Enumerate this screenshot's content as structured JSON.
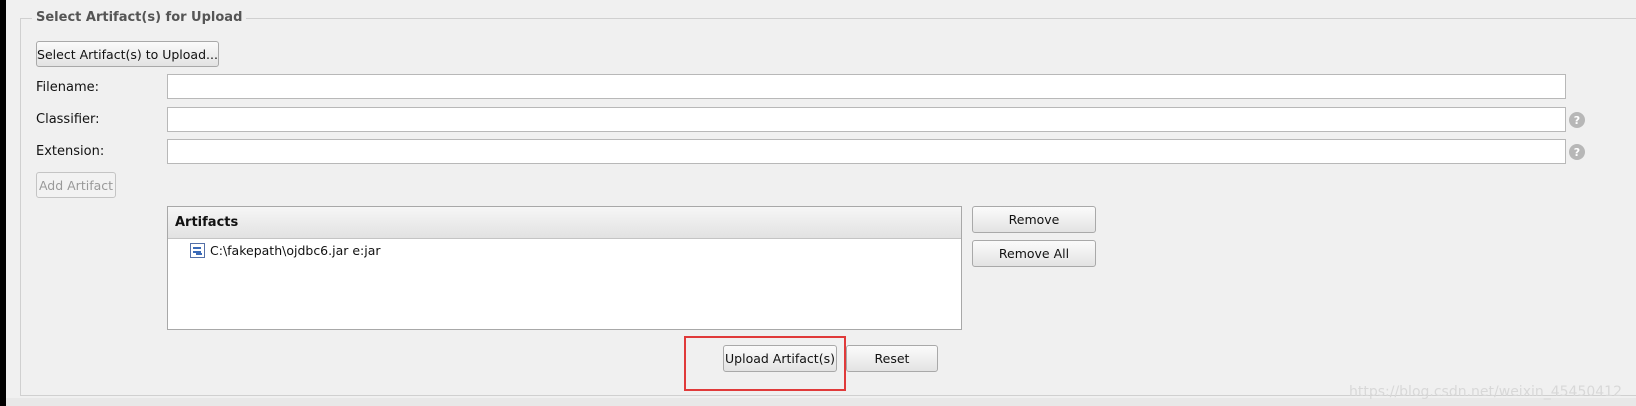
{
  "fieldset": {
    "legend": "Select Artifact(s) for Upload"
  },
  "select_button": {
    "label": "Select Artifact(s) to Upload..."
  },
  "fields": {
    "filename": {
      "label": "Filename:",
      "value": ""
    },
    "classifier": {
      "label": "Classifier:",
      "value": ""
    },
    "extension": {
      "label": "Extension:",
      "value": ""
    }
  },
  "help_icon": "?",
  "add_artifact": {
    "label": "Add Artifact",
    "disabled": true
  },
  "artifacts": {
    "header": "Artifacts",
    "rows": [
      {
        "text": "C:\\fakepath\\ojdbc6.jar e:jar"
      }
    ]
  },
  "remove_button": {
    "label": "Remove"
  },
  "remove_all_button": {
    "label": "Remove All"
  },
  "upload_button": {
    "label": "Upload Artifact(s)"
  },
  "reset_button": {
    "label": "Reset"
  },
  "watermark": "https://blog.csdn.net/weixin_45450412",
  "colors": {
    "highlight": "#e03a3a",
    "background": "#f0f0f0"
  }
}
